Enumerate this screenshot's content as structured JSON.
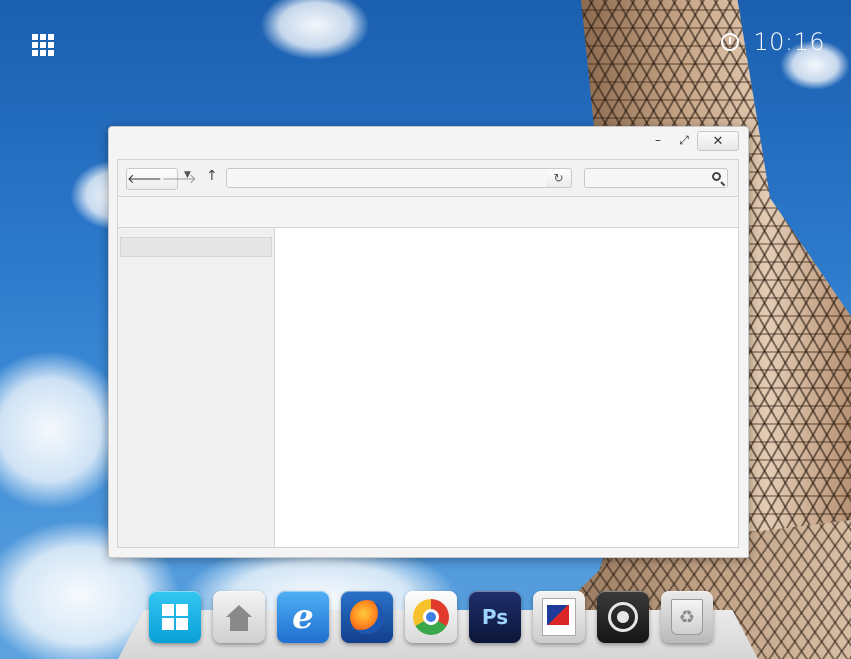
{
  "desktop": {
    "clock": "10:16"
  },
  "window": {
    "controls": {
      "minimize": "–",
      "maximize": "⤢",
      "close": "✕"
    },
    "toolbar": {
      "back": "🡐",
      "forward": "🡒",
      "history_dropdown": "▼",
      "up": "↑",
      "address_value": "",
      "address_dropdown": "⌄",
      "refresh": "↻",
      "search_value": ""
    },
    "sidebar": {
      "items": [
        {
          "label": ""
        }
      ]
    }
  },
  "dock": {
    "items": [
      {
        "name": "windows-start",
        "icon": "windows-logo-icon"
      },
      {
        "name": "home-folder",
        "icon": "home-icon"
      },
      {
        "name": "internet-explorer",
        "icon": "internet-explorer-icon",
        "glyph": "e"
      },
      {
        "name": "firefox",
        "icon": "firefox-icon"
      },
      {
        "name": "chrome",
        "icon": "chrome-icon"
      },
      {
        "name": "photoshop",
        "icon": "photoshop-icon",
        "glyph": "Ps"
      },
      {
        "name": "pdf-reader",
        "icon": "pdf-icon"
      },
      {
        "name": "steam",
        "icon": "steam-icon"
      },
      {
        "name": "recycle-bin",
        "icon": "recycle-bin-icon",
        "glyph": "♻"
      }
    ]
  }
}
